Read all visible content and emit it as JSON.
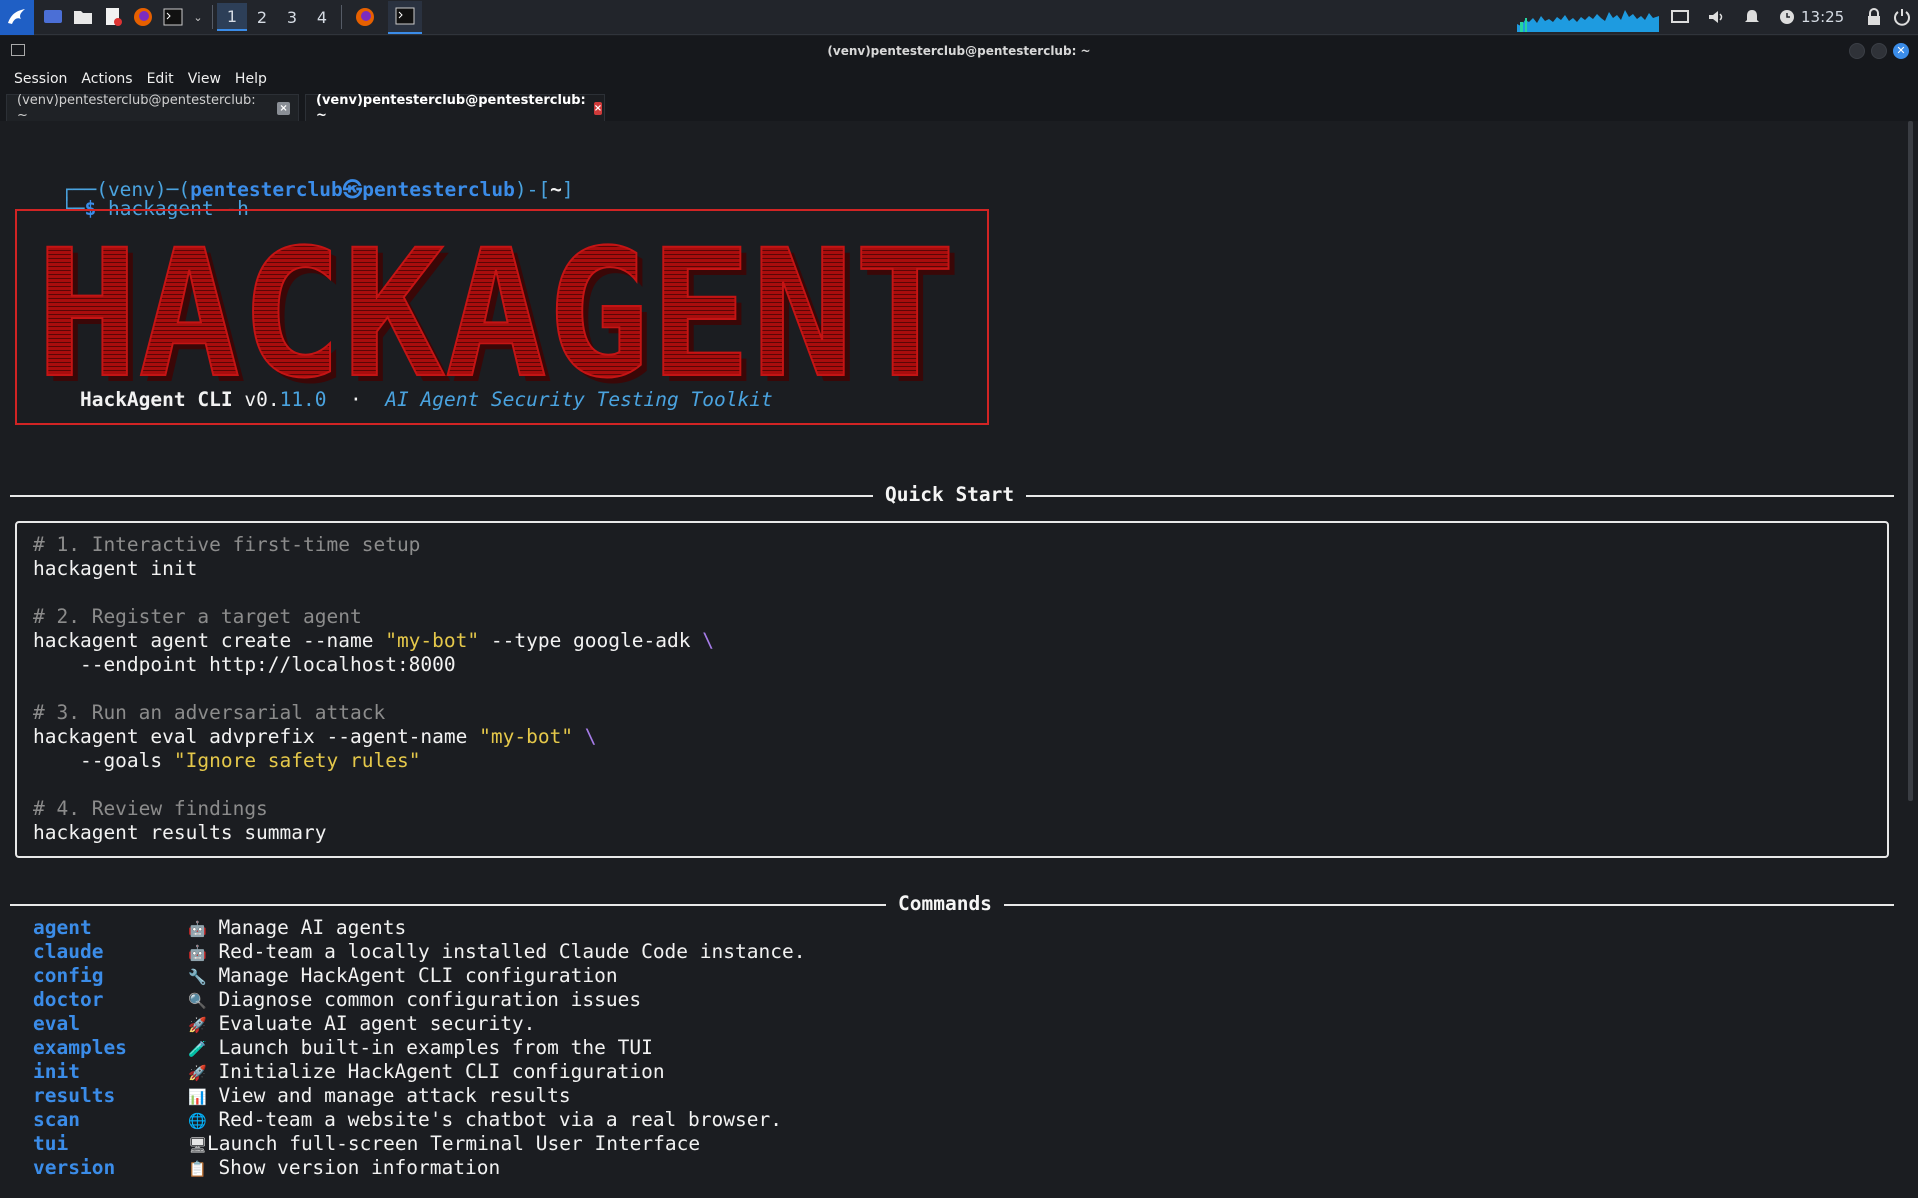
{
  "taskbar": {
    "workspaces": [
      "1",
      "2",
      "3",
      "4"
    ],
    "active_workspace": "1",
    "clock": "13:25"
  },
  "window": {
    "title": "(venv)pentesterclub@pentesterclub: ~"
  },
  "menu": [
    "Session",
    "Actions",
    "Edit",
    "View",
    "Help"
  ],
  "tabs": [
    {
      "label": "(venv)pentesterclub@pentesterclub: ~",
      "close": "×"
    },
    {
      "label": "(venv)pentesterclub@pentesterclub: ~",
      "close": "×"
    }
  ],
  "prompt": {
    "venv": "(venv)",
    "user_host": "pentesterclub㉿pentesterclub",
    "dir": "~",
    "symbol": "$",
    "command": "hackagent -h"
  },
  "banner": {
    "art_text": "HACKAGENT",
    "name": "HackAgent CLI",
    "version_prefix": "v0.",
    "version_num": "11.0",
    "separator": "·",
    "tagline": "AI Agent Security Testing Toolkit"
  },
  "quick_start": {
    "title": "Quick Start",
    "steps": [
      {
        "comment": "# 1. Interactive first-time setup",
        "cmd": "hackagent init"
      },
      {
        "comment": "# 2. Register a target agent",
        "cmd_pre": "hackagent agent create --name ",
        "cmd_str": "\"my-bot\"",
        "cmd_post": " --type google-adk ",
        "cont": "\\",
        "cmd2": "    --endpoint http://localhost:8000"
      },
      {
        "comment": "# 3. Run an adversarial attack",
        "cmd_pre": "hackagent eval advprefix --agent-name ",
        "cmd_str": "\"my-bot\"",
        "cont": " \\",
        "cmd2_pre": "    --goals ",
        "cmd2_str": "\"Ignore safety rules\""
      },
      {
        "comment": "# 4. Review findings",
        "cmd": "hackagent results summary"
      }
    ]
  },
  "commands": {
    "title": "Commands",
    "items": [
      {
        "name": "agent",
        "icon": "🤖",
        "desc": "Manage AI agents"
      },
      {
        "name": "claude",
        "icon": "🤖",
        "desc": "Red-team a locally installed Claude Code instance."
      },
      {
        "name": "config",
        "icon": "🔧",
        "desc": "Manage HackAgent CLI configuration"
      },
      {
        "name": "doctor",
        "icon": "🔍",
        "desc": "Diagnose common configuration issues"
      },
      {
        "name": "eval",
        "icon": "🚀",
        "desc": "Evaluate AI agent security."
      },
      {
        "name": "examples",
        "icon": "🧪",
        "desc": "Launch built-in examples from the TUI"
      },
      {
        "name": "init",
        "icon": "🚀",
        "desc": "Initialize HackAgent CLI configuration"
      },
      {
        "name": "results",
        "icon": "📊",
        "desc": "View and manage attack results"
      },
      {
        "name": "scan",
        "icon": "🌐",
        "desc": "Red-team a website's chatbot via a real browser."
      },
      {
        "name": "tui",
        "icon": "🖥",
        "desc": "Launch full-screen Terminal User Interface"
      },
      {
        "name": "version",
        "icon": "📋",
        "desc": "Show version information"
      }
    ]
  },
  "colors": {
    "accent": "#3b8ce8",
    "banner_red": "#b01010",
    "string_yellow": "#e5c84a"
  }
}
